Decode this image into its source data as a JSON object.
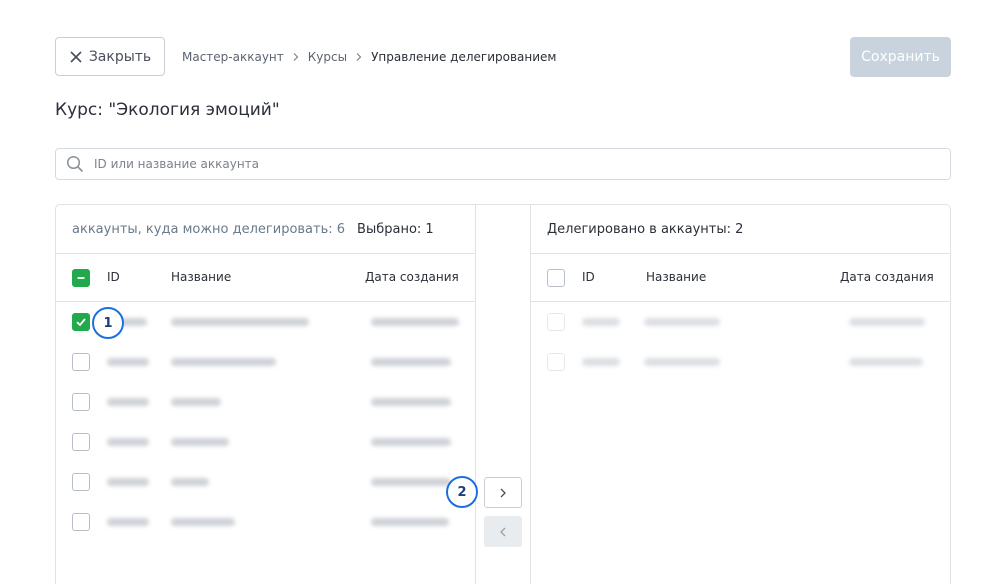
{
  "header": {
    "close_label": "Закрыть",
    "save_label": "Сохранить",
    "breadcrumb": [
      "Мастер-аккаунт",
      "Курсы",
      "Управление делегированием"
    ]
  },
  "course": {
    "title": "Курс: \"Экология эмоций\""
  },
  "search": {
    "placeholder": "ID или название аккаунта",
    "value": ""
  },
  "left_panel": {
    "title": "аккаунты, куда можно делегировать: 6",
    "selected": "Выбрано: 1",
    "columns": {
      "id": "ID",
      "name": "Название",
      "date": "Дата создания"
    },
    "rows": [
      {
        "checked": true
      },
      {
        "checked": false
      },
      {
        "checked": false
      },
      {
        "checked": false
      },
      {
        "checked": false
      },
      {
        "checked": false
      }
    ]
  },
  "right_panel": {
    "title": "Делегировано в аккаунты: 2",
    "columns": {
      "id": "ID",
      "name": "Название",
      "date": "Дата создания"
    },
    "rows": [
      {
        "checked": false
      },
      {
        "checked": false
      }
    ]
  },
  "markers": {
    "first": "1",
    "second": "2"
  },
  "colors": {
    "accent_green": "#21a94b",
    "marker_blue": "#1d6fe0",
    "save_disabled": "#c9d3dd"
  },
  "icons": {
    "close": "close-icon",
    "breadcrumb_separator": "chevron-right-icon",
    "search": "search-icon",
    "move_right": "chevron-right-icon",
    "move_left": "chevron-left-icon"
  }
}
